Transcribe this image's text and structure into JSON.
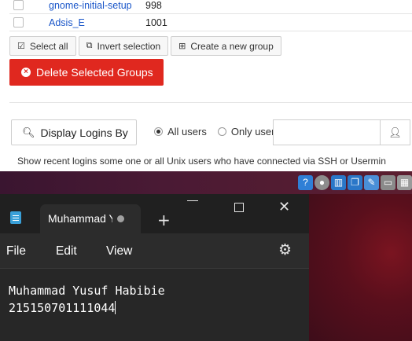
{
  "webmin": {
    "groups": [
      {
        "name": "gnome-initial-setup",
        "gid": "998"
      },
      {
        "name": "Adsis_E",
        "gid": "1001"
      }
    ],
    "buttons": {
      "select_all": "Select all",
      "invert_selection": "Invert selection",
      "create_group": "Create a new group",
      "delete_groups": "Delete Selected Groups"
    },
    "logins": {
      "display_button": "Display Logins By",
      "all_users_label": "All users",
      "only_user_label": "Only user",
      "selected": "All users",
      "user_value": "",
      "help_text": "Show recent logins some one or all Unix users who have connected via SSH or Usermin"
    },
    "colors": {
      "link": "#1a56c9",
      "danger": "#e0281f"
    }
  },
  "tray_icons": [
    "help-icon",
    "disc-icon",
    "network-icon",
    "windows-icon",
    "pen-icon",
    "display-icon",
    "hdd-icon"
  ],
  "notepad": {
    "tab_title": "Muhammad Yusuf Habibie",
    "menu": {
      "file": "File",
      "edit": "Edit",
      "view": "View"
    },
    "lines": [
      "Muhammad Yusuf Habibie",
      "215150701111044"
    ]
  }
}
